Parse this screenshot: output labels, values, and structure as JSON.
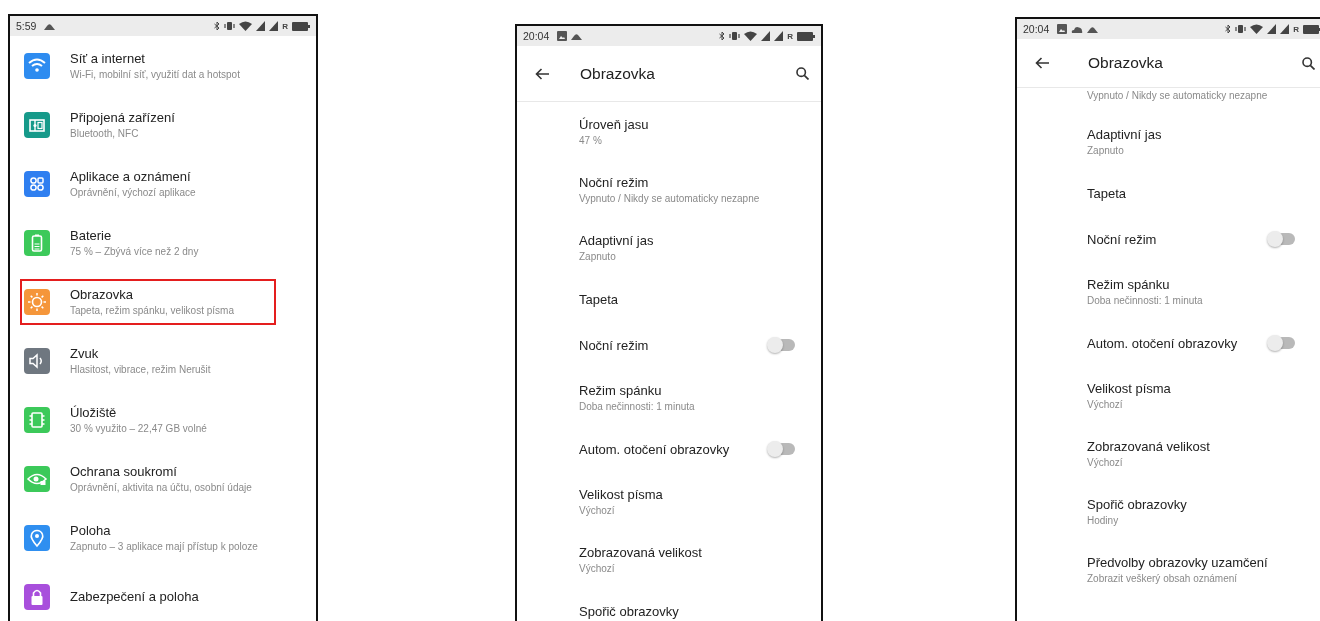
{
  "screens": [
    {
      "kind": "settings_list",
      "status_bar": {
        "time": "5:59",
        "roaming": "R"
      },
      "items": [
        {
          "title": "Síť a internet",
          "subtitle": "Wi-Fi, mobilní síť, využití dat a hotspot",
          "color": "#2e8cf0",
          "highlighted": false
        },
        {
          "title": "Připojená zařízení",
          "subtitle": "Bluetooth, NFC",
          "color": "#169a8a",
          "highlighted": false
        },
        {
          "title": "Aplikace a oznámení",
          "subtitle": "Oprávnění, výchozí aplikace",
          "color": "#2f7ff0",
          "highlighted": false
        },
        {
          "title": "Baterie",
          "subtitle": "75 % – Zbývá více než 2 dny",
          "color": "#3cc95a",
          "highlighted": false
        },
        {
          "title": "Obrazovka",
          "subtitle": "Tapeta, režim spánku, velikost písma",
          "color": "#f5963a",
          "highlighted": true
        },
        {
          "title": "Zvuk",
          "subtitle": "Hlasitost, vibrace, režim Nerušit",
          "color": "#6f7780",
          "highlighted": false
        },
        {
          "title": "Úložiště",
          "subtitle": "30 % využito – 22,47 GB volné",
          "color": "#3cc95a",
          "highlighted": false
        },
        {
          "title": "Ochrana soukromí",
          "subtitle": "Oprávnění, aktivita na účtu, osobní údaje",
          "color": "#3cc95a",
          "highlighted": false
        },
        {
          "title": "Poloha",
          "subtitle": "Zapnuto – 3 aplikace mají přístup k poloze",
          "color": "#2f8ff0",
          "highlighted": false
        },
        {
          "title": "Zabezpečení a poloha",
          "color": "#a84fdc",
          "highlighted": false
        }
      ]
    },
    {
      "kind": "detail",
      "status_bar": {
        "time": "20:04",
        "roaming": "R"
      },
      "app_bar": {
        "title": "Obrazovka"
      },
      "items": [
        {
          "kind": "text",
          "title": "Úroveň jasu",
          "subtitle": "47 %"
        },
        {
          "kind": "text",
          "title": "Noční režim",
          "subtitle": "Vypnuto / Nikdy se automaticky nezapne"
        },
        {
          "kind": "text",
          "title": "Adaptivní jas",
          "subtitle": "Zapnuto"
        },
        {
          "kind": "text",
          "title": "Tapeta"
        },
        {
          "kind": "toggle",
          "title": "Noční režim",
          "on": false
        },
        {
          "kind": "text",
          "title": "Režim spánku",
          "subtitle": "Doba nečinnosti: 1 minuta"
        },
        {
          "kind": "toggle",
          "title": "Autom. otočení obrazovky",
          "on": false
        },
        {
          "kind": "text",
          "title": "Velikost písma",
          "subtitle": "Výchozí"
        },
        {
          "kind": "text",
          "title": "Zobrazovaná velikost",
          "subtitle": "Výchozí"
        },
        {
          "kind": "text",
          "title": "Spořič obrazovky"
        }
      ]
    },
    {
      "kind": "detail",
      "status_bar": {
        "time": "20:04",
        "roaming": "R"
      },
      "app_bar": {
        "title": "Obrazovka"
      },
      "items": [
        {
          "kind": "partial",
          "subtitle": "Vypnuto / Nikdy se automaticky nezapne"
        },
        {
          "kind": "text",
          "title": "Adaptivní jas",
          "subtitle": "Zapnuto"
        },
        {
          "kind": "text",
          "title": "Tapeta"
        },
        {
          "kind": "toggle",
          "title": "Noční režim",
          "on": false
        },
        {
          "kind": "text",
          "title": "Režim spánku",
          "subtitle": "Doba nečinnosti: 1 minuta"
        },
        {
          "kind": "toggle",
          "title": "Autom. otočení obrazovky",
          "on": false
        },
        {
          "kind": "text",
          "title": "Velikost písma",
          "subtitle": "Výchozí"
        },
        {
          "kind": "text",
          "title": "Zobrazovaná velikost",
          "subtitle": "Výchozí"
        },
        {
          "kind": "text",
          "title": "Spořič obrazovky",
          "subtitle": "Hodiny"
        },
        {
          "kind": "text",
          "title": "Předvolby obrazovky uzamčení",
          "subtitle": "Zobrazit veškerý obsah oznámení"
        }
      ]
    }
  ]
}
